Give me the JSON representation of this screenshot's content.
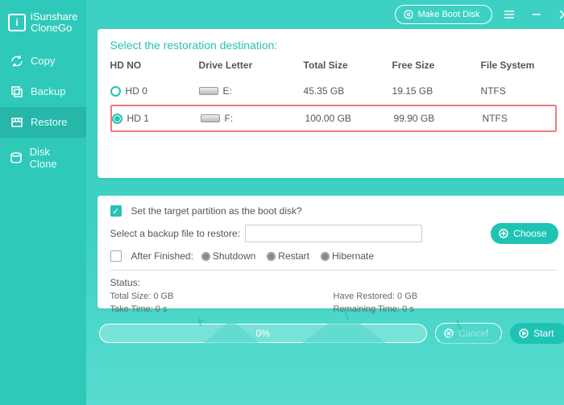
{
  "app": {
    "brand_line1": "iSunshare",
    "brand_line2": "CloneGo"
  },
  "titlebar": {
    "make_boot": "Make Boot Disk"
  },
  "nav": {
    "copy": "Copy",
    "backup": "Backup",
    "restore": "Restore",
    "diskclone": "Disk Clone"
  },
  "panel1": {
    "heading": "Select the restoration destination:",
    "cols": {
      "hd": "HD NO",
      "letter": "Drive Letter",
      "total": "Total Size",
      "free": "Free Size",
      "fs": "File System"
    },
    "rows": [
      {
        "hd": "HD 0",
        "letter": "E:",
        "total": "45.35 GB",
        "free": "19.15 GB",
        "fs": "NTFS",
        "selected": false
      },
      {
        "hd": "HD 1",
        "letter": "F:",
        "total": "100.00 GB",
        "free": "99.90 GB",
        "fs": "NTFS",
        "selected": true
      }
    ]
  },
  "panel2": {
    "set_target": "Set the target partition as the boot disk?",
    "select_backup": "Select a backup file to restore:",
    "choose": "Choose",
    "after": "After Finished:",
    "opts": {
      "shutdown": "Shutdown",
      "restart": "Restart",
      "hibernate": "Hibernate"
    },
    "status_label": "Status:",
    "total": "Total Size: 0 GB",
    "restored": "Have Restored: 0 GB",
    "take": "Take Time: 0 s",
    "remain": "Remaining Time: 0 s",
    "backup_value": ""
  },
  "footer": {
    "progress": "0%",
    "cancel": "Cancel",
    "start": "Start"
  }
}
